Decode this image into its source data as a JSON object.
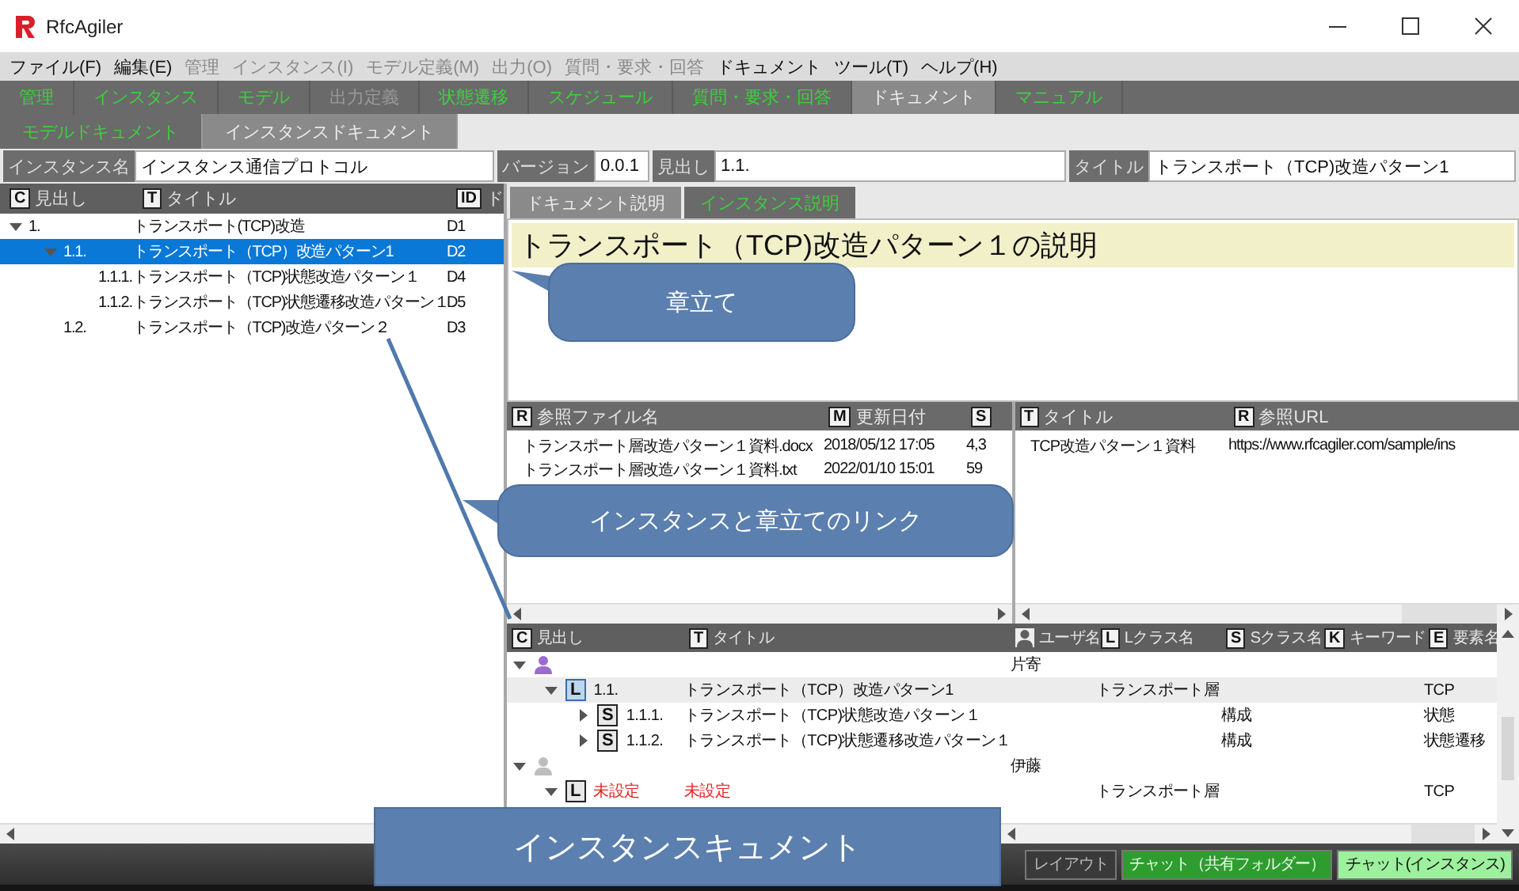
{
  "window": {
    "title": "RfcAgiler"
  },
  "menu": [
    {
      "label": "ファイル(F)",
      "disabled": false
    },
    {
      "label": "編集(E)",
      "disabled": false
    },
    {
      "label": "管理",
      "disabled": true
    },
    {
      "label": "インスタンス(I)",
      "disabled": true
    },
    {
      "label": "モデル定義(M)",
      "disabled": true
    },
    {
      "label": "出力(O)",
      "disabled": true
    },
    {
      "label": "質問・要求・回答",
      "disabled": true
    },
    {
      "label": "ドキュメント",
      "disabled": false
    },
    {
      "label": "ツール(T)",
      "disabled": false
    },
    {
      "label": "ヘルプ(H)",
      "disabled": false
    }
  ],
  "toolbar": [
    {
      "label": "管理",
      "selected": false,
      "disabled": false
    },
    {
      "label": "インスタンス",
      "selected": false,
      "disabled": false
    },
    {
      "label": "モデル",
      "selected": false,
      "disabled": false
    },
    {
      "label": "出力定義",
      "selected": false,
      "disabled": true
    },
    {
      "label": "状態遷移",
      "selected": false,
      "disabled": false
    },
    {
      "label": "スケジュール",
      "selected": false,
      "disabled": false
    },
    {
      "label": "質問・要求・回答",
      "selected": false,
      "disabled": false
    },
    {
      "label": "ドキュメント",
      "selected": true,
      "disabled": false
    },
    {
      "label": "マニュアル",
      "selected": false,
      "disabled": false
    }
  ],
  "subtabs": [
    {
      "label": "モデルドキュメント",
      "selected": false,
      "disabled": false
    },
    {
      "label": "インスタンスドキュメント",
      "selected": true,
      "disabled": false
    }
  ],
  "fields": [
    {
      "label": "インスタンス名",
      "value": "インスタンス通信プロトコル"
    },
    {
      "label": "バージョン",
      "value": "0.0.1"
    },
    {
      "label": "見出し",
      "value": "1.1."
    },
    {
      "label": "タイトル",
      "value": "トランスポート（TCP)改造パターン1"
    }
  ],
  "doc_tree": {
    "columns": [
      {
        "badge": "C",
        "label": "見出し"
      },
      {
        "badge": "T",
        "label": "タイトル"
      },
      {
        "badge": "ID",
        "label": "ド"
      }
    ],
    "rows": [
      {
        "heading": "1.",
        "title": "トランスポート(TCP)改造",
        "id": "D1",
        "expanded": true,
        "selected": false,
        "children": [
          {
            "heading": "1.1.",
            "title": "トランスポート（TCP）改造パターン1",
            "id": "D2",
            "expanded": true,
            "selected": true,
            "children": [
              {
                "heading": "1.1.1.",
                "title": "トランスポート（TCP)状態改造パターン１",
                "id": "D4",
                "selected": false
              },
              {
                "heading": "1.1.2.",
                "title": "トランスポート（TCP)状態遷移改造パターン１",
                "id": "D5",
                "selected": false
              }
            ]
          },
          {
            "heading": "1.2.",
            "title": "トランスポート（TCP)改造パターン２",
            "id": "D3",
            "selected": false
          }
        ]
      }
    ]
  },
  "description": {
    "tabs": [
      {
        "label": "ドキュメント説明",
        "selected": true
      },
      {
        "label": "インスタンス説明",
        "selected": false
      }
    ],
    "heading": "トランスポート（TCP)改造パターン１の説明"
  },
  "reference_files": {
    "columns": [
      {
        "badge": "R",
        "label": "参照ファイル名"
      },
      {
        "badge": "M",
        "label": "更新日付"
      },
      {
        "badge": "S"
      }
    ],
    "rows": [
      [
        "トランスポート層改造パターン１資料.docx",
        "2018/05/12 17:05",
        "4,3"
      ],
      [
        "トランスポート層改造パターン１資料.txt",
        "2022/01/10 15:01",
        "59"
      ]
    ]
  },
  "reference_urls": {
    "columns": [
      {
        "badge": "T",
        "label": "タイトル"
      },
      {
        "badge": "R",
        "label": "参照URL"
      }
    ],
    "rows": [
      [
        "TCP改造パターン１資料",
        "https://www.rfcagiler.com/sample/ins"
      ]
    ]
  },
  "instance_tree": {
    "columns": [
      {
        "kind": "badge",
        "badge": "C",
        "label": "見出し"
      },
      {
        "kind": "badge",
        "badge": "T",
        "label": "タイトル"
      },
      {
        "kind": "user",
        "label": "ユーザ名"
      },
      {
        "kind": "badge",
        "badge": "L",
        "label": "Lクラス名"
      },
      {
        "kind": "badge",
        "badge": "S",
        "label": "Sクラス名"
      },
      {
        "kind": "badge",
        "badge": "K",
        "label": "キーワード"
      },
      {
        "kind": "badge",
        "badge": "E",
        "label": "要素名"
      }
    ],
    "rows": [
      {
        "kind": "user",
        "color": "#9b6bd0",
        "user": "片寄",
        "expanded": true,
        "selected": false,
        "children": [
          {
            "kind": "item",
            "badge": "L",
            "heading": "1.1.",
            "title": "トランスポート（TCP）改造パターン1",
            "lclass": "トランスポート層",
            "element": "TCP",
            "expanded": true,
            "selected": true,
            "unset": false,
            "children": [
              {
                "kind": "item",
                "badge": "S",
                "heading": "1.1.1.",
                "title": "トランスポート（TCP)状態改造パターン１",
                "sclass": "構成",
                "element": "状態",
                "expanded": false,
                "selected": false,
                "unset": false
              },
              {
                "kind": "item",
                "badge": "S",
                "heading": "1.1.2.",
                "title": "トランスポート（TCP)状態遷移改造パターン１",
                "sclass": "構成",
                "element": "状態遷移",
                "expanded": false,
                "selected": false,
                "unset": false
              }
            ]
          }
        ]
      },
      {
        "kind": "user",
        "color": "#bdbdbd",
        "user": "伊藤",
        "expanded": true,
        "selected": false,
        "children": [
          {
            "kind": "item",
            "badge": "L",
            "heading": "未設定",
            "title": "未設定",
            "lclass": "トランスポート層",
            "element": "TCP",
            "expanded": true,
            "selected": false,
            "unset": true
          }
        ]
      }
    ]
  },
  "status_bar": {
    "buttons": [
      {
        "label": "レイアウト",
        "kind": "plain"
      },
      {
        "label": "チャット（共有フォルダー）",
        "kind": "green"
      },
      {
        "label": "チャット(インスタンス)",
        "kind": "light"
      }
    ]
  },
  "callouts": [
    {
      "kind": "bubble",
      "text": "章立て"
    },
    {
      "kind": "bubble",
      "text": "インスタンスと章立てのリンク"
    },
    {
      "kind": "banner",
      "text": "インスタンスキュメント"
    }
  ]
}
